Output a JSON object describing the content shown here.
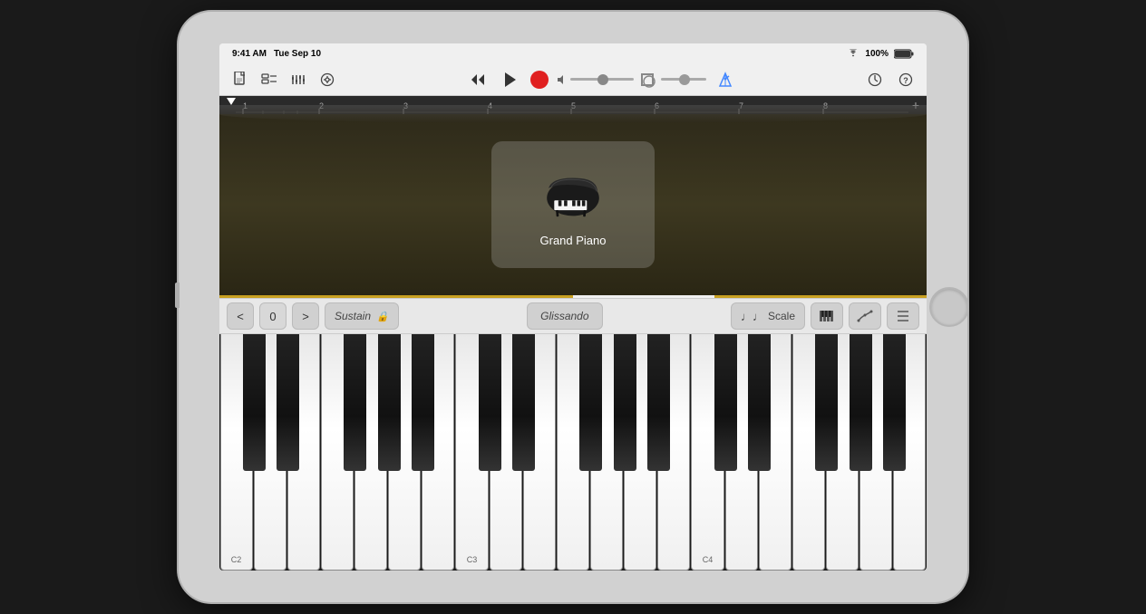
{
  "status_bar": {
    "time": "9:41 AM",
    "date": "Tue Sep 10",
    "wifi": "WiFi",
    "battery": "100%"
  },
  "toolbar": {
    "new_song_label": "📄",
    "tracks_label": "⊞",
    "mixer_label": "≡",
    "settings_eq_label": "⚙",
    "rewind_label": "⏮",
    "play_label": "▶",
    "record_label": "●",
    "volume_label": "vol",
    "metronome_label": "𝅘𝅥𝅮",
    "clock_label": "⏱",
    "help_label": "?"
  },
  "timeline": {
    "add_label": "+",
    "markers": [
      "1",
      "2",
      "3",
      "4",
      "5",
      "6",
      "7",
      "8"
    ]
  },
  "instrument": {
    "name": "Grand Piano",
    "icon": "grand_piano"
  },
  "controls": {
    "prev_octave": "<",
    "octave_value": "0",
    "next_octave": ">",
    "sustain_label": "Sustain",
    "glissando_label": "Glissando",
    "scale_label": "Scale",
    "notes_icon": "♩♩",
    "arpeggio_icon": "arp",
    "settings_icon": "≡"
  },
  "keyboard": {
    "octave_labels": [
      "C2",
      "C3",
      "C4"
    ]
  },
  "colors": {
    "record_red": "#e02020",
    "accent_gold": "#c8a020",
    "metronome_blue": "#4488ff",
    "toolbar_bg": "#f0f0f0",
    "instrument_bg": "#332e18",
    "keyboard_white": "#f5f5f5",
    "keyboard_black": "#111111"
  }
}
